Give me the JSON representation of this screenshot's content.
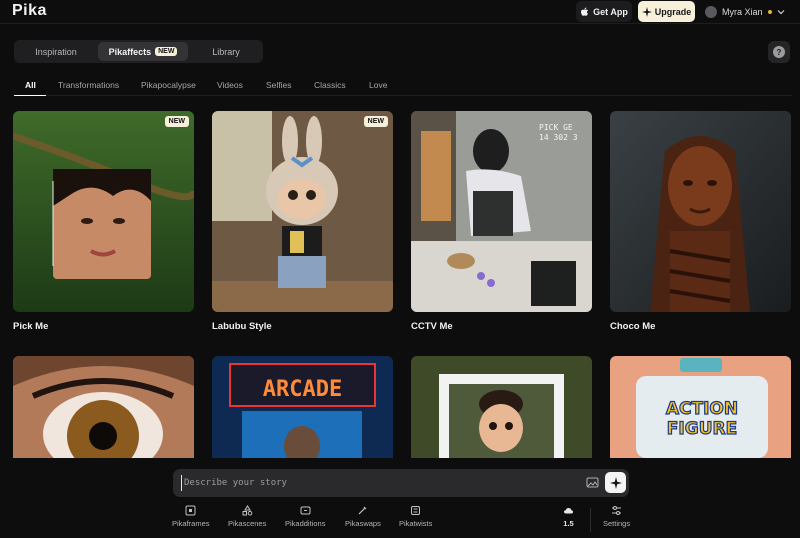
{
  "app": {
    "logo": "Pika"
  },
  "header": {
    "get_app": "Get App",
    "upgrade": "Upgrade",
    "user_name": "Myra Xian"
  },
  "tabs": [
    {
      "label": "Inspiration",
      "active": false
    },
    {
      "label": "Pikaffects",
      "active": true,
      "badge": "NEW"
    },
    {
      "label": "Library",
      "active": false
    }
  ],
  "help": {
    "label": "?"
  },
  "categories": [
    "All",
    "Transformations",
    "Pikapocalypse",
    "Videos",
    "Selfies",
    "Classics",
    "Love"
  ],
  "categories_active": "All",
  "cards": [
    {
      "title": "Pick Me",
      "badge": "NEW"
    },
    {
      "title": "Labubu Style",
      "badge": "NEW"
    },
    {
      "title": "CCTV Me",
      "overlay": "PICK GE\n14 302 3"
    },
    {
      "title": "Choco Me"
    }
  ],
  "cards_row2": [
    {
      "name": "eye"
    },
    {
      "name": "arcade",
      "text": "ARCADE"
    },
    {
      "name": "cartoon-portrait"
    },
    {
      "name": "action-figure",
      "text_line1": "ACTION",
      "text_line2": "FIGURE"
    }
  ],
  "prompt": {
    "placeholder": "Describe your story"
  },
  "tools": [
    {
      "label": "Pikaframes",
      "icon": "frame-icon"
    },
    {
      "label": "Pikascenes",
      "icon": "shapes-icon"
    },
    {
      "label": "Pikadditions",
      "icon": "addition-icon"
    },
    {
      "label": "Pikaswaps",
      "icon": "swap-brush-icon"
    },
    {
      "label": "Pikatwists",
      "icon": "twist-icon"
    }
  ],
  "model": {
    "label": "1.5"
  },
  "settings": {
    "label": "Settings"
  },
  "colors": {
    "background": "#0d0d0e",
    "badge": "#f6efd9",
    "accent_dot": "#e2b43a"
  }
}
